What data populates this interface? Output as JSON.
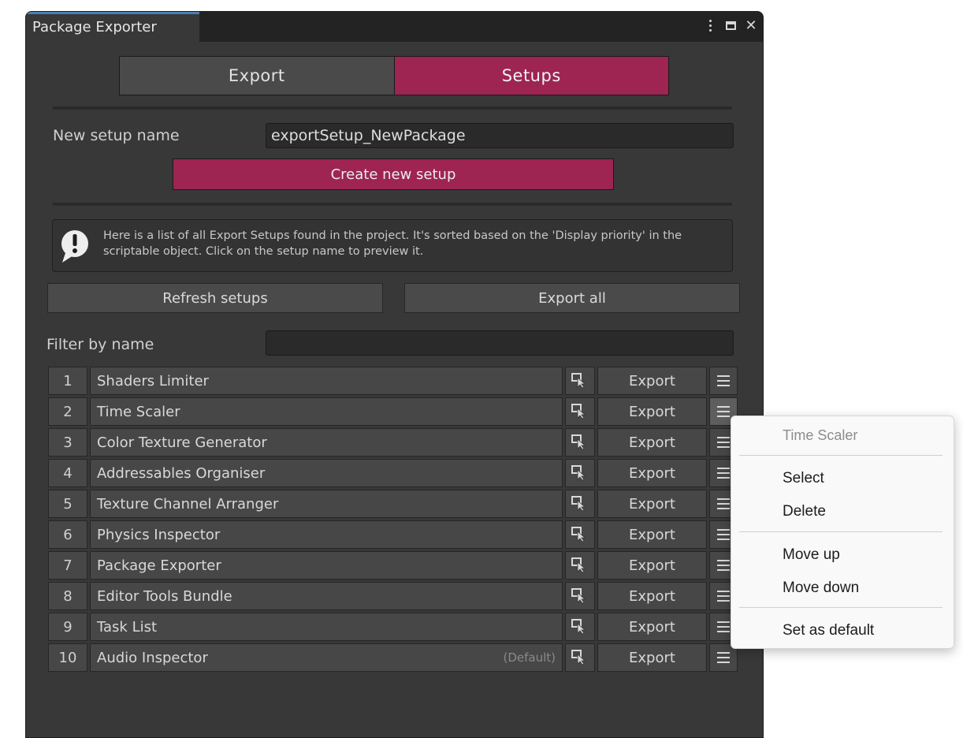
{
  "window": {
    "title": "Package Exporter"
  },
  "mode_tabs": {
    "export": "Export",
    "setups": "Setups"
  },
  "new_setup": {
    "label": "New setup name",
    "value": "exportSetup_NewPackage",
    "create_button": "Create new setup"
  },
  "info": {
    "text": "Here is a list of all Export Setups found in the project. It's sorted based on the 'Display priority' in the scriptable object. Click on the setup name to preview it."
  },
  "actions": {
    "refresh": "Refresh setups",
    "export_all": "Export all"
  },
  "filter": {
    "label": "Filter by name",
    "value": ""
  },
  "setups": [
    {
      "num": "1",
      "name": "Shaders Limiter",
      "default": "",
      "export": "Export"
    },
    {
      "num": "2",
      "name": "Time Scaler",
      "default": "",
      "export": "Export"
    },
    {
      "num": "3",
      "name": "Color Texture Generator",
      "default": "",
      "export": "Export"
    },
    {
      "num": "4",
      "name": "Addressables Organiser",
      "default": "",
      "export": "Export"
    },
    {
      "num": "5",
      "name": "Texture Channel Arranger",
      "default": "",
      "export": "Export"
    },
    {
      "num": "6",
      "name": "Physics Inspector",
      "default": "",
      "export": "Export"
    },
    {
      "num": "7",
      "name": "Package Exporter",
      "default": "",
      "export": "Export"
    },
    {
      "num": "8",
      "name": "Editor Tools Bundle",
      "default": "",
      "export": "Export"
    },
    {
      "num": "9",
      "name": "Task List",
      "default": "",
      "export": "Export"
    },
    {
      "num": "10",
      "name": "Audio Inspector",
      "default": "(Default)",
      "export": "Export"
    }
  ],
  "context_menu": {
    "header": "Time Scaler",
    "select": "Select",
    "delete": "Delete",
    "move_up": "Move up",
    "move_down": "Move down",
    "set_default": "Set as default"
  },
  "colors": {
    "accent": "#9e2452",
    "panel": "#383838",
    "tab_highlight": "#4a7fb5"
  }
}
